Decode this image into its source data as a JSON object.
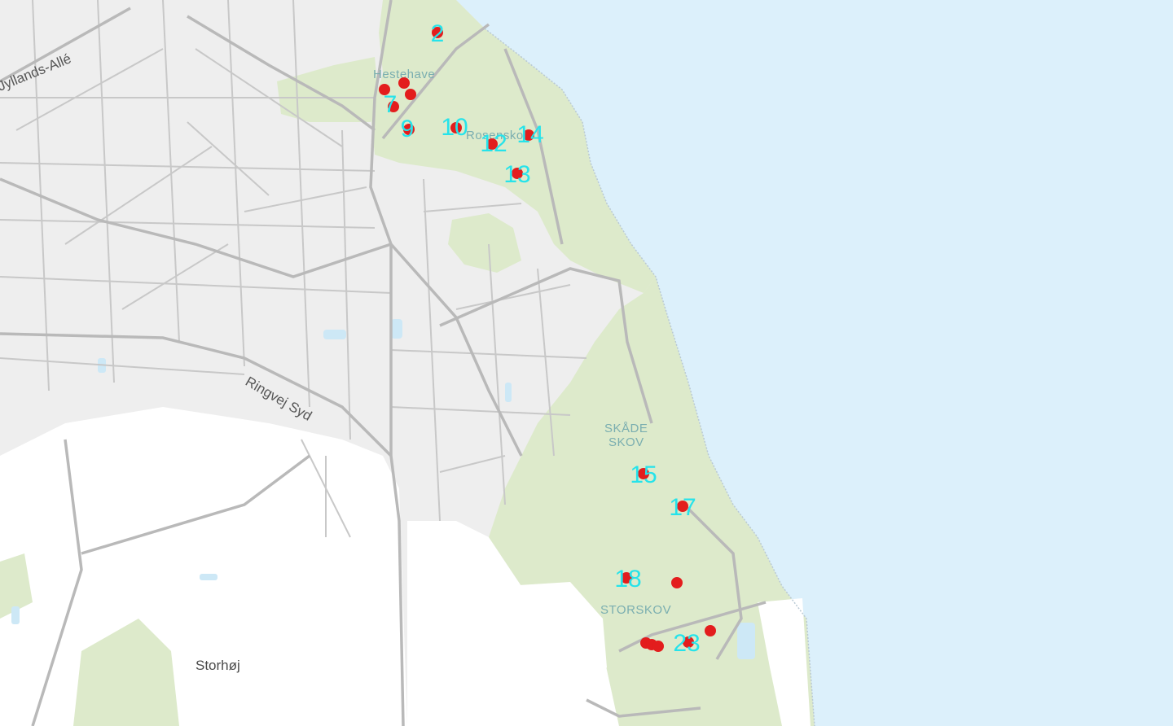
{
  "map": {
    "colors": {
      "sea": "#dcf0fb",
      "urban": "#eeeeee",
      "rural": "#ffffff",
      "forest": "#ddeacb",
      "road": "#c8c8c8",
      "major_road": "#b9b9b9",
      "marker": "#e31d1d",
      "marker_label": "#26e3ea",
      "forest_label": "#7aaeb0",
      "lake": "#cde8f6"
    },
    "labels": {
      "jyllands_alle": "Jyllands-Allé",
      "hestehave": "Hestehave",
      "rosenskov": "Rosenskov",
      "ringvej_syd": "Ringvej Syd",
      "skaade": "SKÅDE",
      "skov": "SKOV",
      "storskov": "STORSKOV",
      "storhoj": "Storhøj"
    },
    "markers": [
      {
        "label": "2"
      },
      {
        "label": ""
      },
      {
        "label": ""
      },
      {
        "label": ""
      },
      {
        "label": "7"
      },
      {
        "label": "9"
      },
      {
        "label": "10"
      },
      {
        "label": "12"
      },
      {
        "label": "14"
      },
      {
        "label": "13"
      },
      {
        "label": "15"
      },
      {
        "label": "17"
      },
      {
        "label": "18"
      },
      {
        "label": ""
      },
      {
        "label": ""
      },
      {
        "label": ""
      },
      {
        "label": ""
      },
      {
        "label": "23"
      },
      {
        "label": ""
      }
    ]
  }
}
